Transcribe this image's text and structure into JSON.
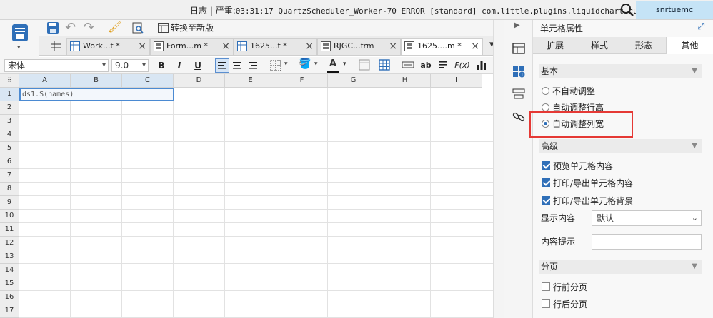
{
  "topbar": {
    "log_label": "日志",
    "separator": "|",
    "severity": "严重:",
    "log_message": "03:31:17 QuartzScheduler_Worker-70 ERROR [standard] com.little.plugins.liquidchart.cu...",
    "user": "snrtuemc"
  },
  "toolbar": {
    "convert_label": "转换至新版"
  },
  "tabs": [
    {
      "label": "Work...t *"
    },
    {
      "label": "Form...m *"
    },
    {
      "label": "1625...t *"
    },
    {
      "label": "RJGC...frm"
    },
    {
      "label": "1625....m *"
    }
  ],
  "format": {
    "font_family": "宋体",
    "font_size": "9.0",
    "bold": "B",
    "italic": "I",
    "underline": "U",
    "text_color_letter": "A",
    "text_ab": "ab",
    "formula": "F(x)"
  },
  "grid": {
    "columns": [
      "A",
      "B",
      "C",
      "D",
      "E",
      "F",
      "G",
      "H",
      "I"
    ],
    "rows": [
      "1",
      "2",
      "3",
      "4",
      "5",
      "6",
      "7",
      "8",
      "9",
      "10",
      "11",
      "12",
      "13",
      "14",
      "15",
      "16",
      "17"
    ],
    "cell_a1": "ds1.S(names)"
  },
  "panel": {
    "title": "单元格属性",
    "tabs": [
      "扩展",
      "样式",
      "形态",
      "其他"
    ],
    "active_tab": "其他",
    "basic": {
      "title": "基本",
      "options": [
        {
          "label": "不自动调整",
          "selected": false
        },
        {
          "label": "自动调整行高",
          "selected": false
        },
        {
          "label": "自动调整列宽",
          "selected": true
        }
      ]
    },
    "advanced": {
      "title": "高级",
      "preview": "预览单元格内容",
      "print_content": "打印/导出单元格内容",
      "print_bg": "打印/导出单元格背景",
      "display_label": "显示内容",
      "display_value": "默认",
      "tooltip_label": "内容提示",
      "tooltip_value": ""
    },
    "paging": {
      "title": "分页",
      "before": "行前分页",
      "after": "行后分页"
    }
  },
  "colors": {
    "accent": "#2f6fb8",
    "highlight": "#e53935"
  }
}
